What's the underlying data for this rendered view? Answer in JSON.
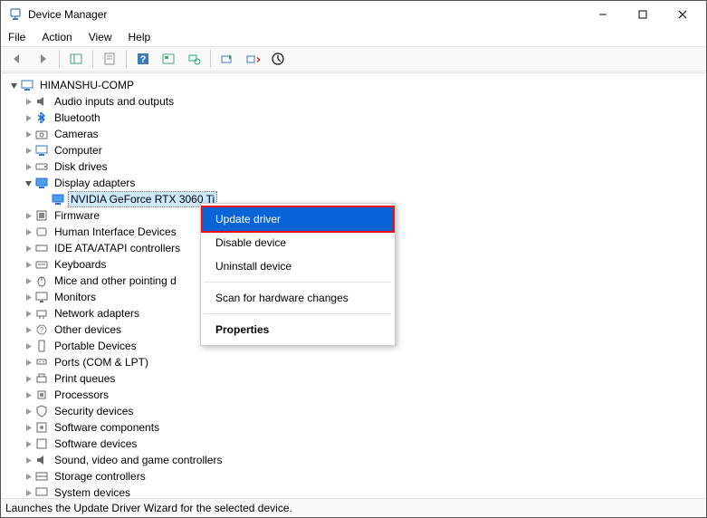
{
  "window": {
    "title": "Device Manager"
  },
  "menu": {
    "file": "File",
    "action": "Action",
    "view": "View",
    "help": "Help"
  },
  "tree": {
    "root": "HIMANSHU-COMP",
    "items": [
      {
        "label": "Audio inputs and outputs"
      },
      {
        "label": "Bluetooth"
      },
      {
        "label": "Cameras"
      },
      {
        "label": "Computer"
      },
      {
        "label": "Disk drives"
      },
      {
        "label": "Display adapters"
      },
      {
        "label": "Firmware"
      },
      {
        "label": "Human Interface Devices"
      },
      {
        "label": "IDE ATA/ATAPI controllers"
      },
      {
        "label": "Keyboards"
      },
      {
        "label": "Mice and other pointing devices"
      },
      {
        "label": "Monitors"
      },
      {
        "label": "Network adapters"
      },
      {
        "label": "Other devices"
      },
      {
        "label": "Portable Devices"
      },
      {
        "label": "Ports (COM & LPT)"
      },
      {
        "label": "Print queues"
      },
      {
        "label": "Processors"
      },
      {
        "label": "Security devices"
      },
      {
        "label": "Software components"
      },
      {
        "label": "Software devices"
      },
      {
        "label": "Sound, video and game controllers"
      },
      {
        "label": "Storage controllers"
      },
      {
        "label": "System devices"
      }
    ],
    "selected_child": "NVIDIA GeForce RTX 3060 Ti"
  },
  "mice_cut": "Mice and other pointing d",
  "context": {
    "update": "Update driver",
    "disable": "Disable device",
    "uninstall": "Uninstall device",
    "scan": "Scan for hardware changes",
    "properties": "Properties"
  },
  "status": "Launches the Update Driver Wizard for the selected device."
}
